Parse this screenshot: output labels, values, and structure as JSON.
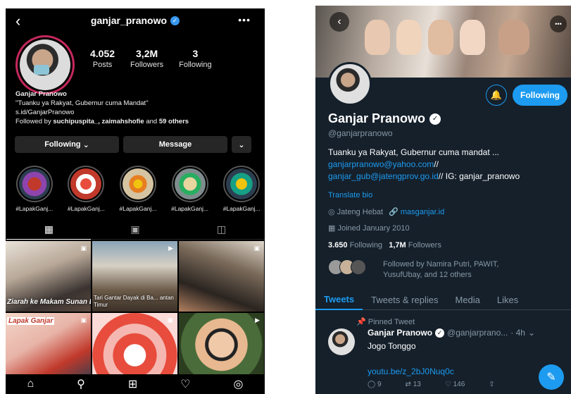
{
  "instagram": {
    "username": "ganjar_pranowo",
    "stats": [
      {
        "value": "4.052",
        "label": "Posts"
      },
      {
        "value": "3,2M",
        "label": "Followers"
      },
      {
        "value": "3",
        "label": "Following"
      }
    ],
    "bio": {
      "name": "Ganjar Pranowo",
      "quote": "\"Tuanku ya Rakyat, Gubernur cuma Mandat\"",
      "link": "s.id/GanjarPranowo",
      "followed_prefix": "Followed by ",
      "followed_users": "suchipuspita_, zaimahshofie",
      "followed_suffix": " and ",
      "followed_count": "59 others"
    },
    "buttons": {
      "following": "Following",
      "message": "Message"
    },
    "highlights": [
      "#LapakGanj...",
      "#LapakGanj...",
      "#LapakGanj...",
      "#LapakGanj...",
      "#LapakGanj..."
    ],
    "posts": [
      {
        "caption": "Ziarah ke Makam Sunan Bajagung"
      },
      {
        "caption": "Tari Gantar Dayak di Ba... antan Timur"
      },
      {
        "caption": ""
      },
      {
        "caption": "Lapak Ganjar"
      },
      {
        "caption": ""
      },
      {
        "caption": ""
      }
    ]
  },
  "twitter": {
    "name": "Ganjar Pranowo",
    "handle": "@ganjarpranowo",
    "follow_button": "Following",
    "bio_line1": "Tuanku ya Rakyat, Gubernur cuma mandat ...",
    "bio_email": "ganjarpranowo@yahoo.com",
    "bio_sep": "//",
    "bio_email2": "ganjar_gub@jatengprov.go.id",
    "bio_ig": "// IG: ganjar_pranowo",
    "translate": "Translate bio",
    "location": "Jateng Hebat",
    "website": "masganjar.id",
    "joined": "Joined January 2010",
    "following_count": "3.650",
    "following_label": " Following",
    "followers_count": "1,7M",
    "followers_label": " Followers",
    "followed_by": "Followed by Namira Putri, PAWIT, YusufUbay, and 12 others",
    "tabs": [
      "Tweets",
      "Tweets & replies",
      "Media",
      "Likes"
    ],
    "pinned_label": "Pinned Tweet",
    "tweet": {
      "name": "Ganjar Pranowo",
      "handle": "@ganjarprano...",
      "time": "· 4h",
      "text": "Jogo Tonggo",
      "link": "youtu.be/z_2bJ0Nuq0c",
      "replies": "9",
      "retweets": "13",
      "likes": "146"
    }
  }
}
